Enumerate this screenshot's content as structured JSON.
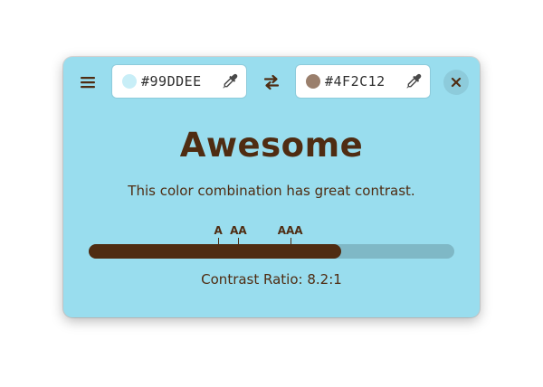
{
  "colors": {
    "background": "#99DDEE",
    "foreground": "#4F2C12",
    "bar_track": "#7fb8c6"
  },
  "header": {
    "menu_icon": "hamburger-menu-icon",
    "foreground_entry": {
      "value": "#99DDEE",
      "swatch_color": "#C8EEF7",
      "picker_icon": "eyedropper-icon"
    },
    "swap_icon": "swap-arrows-icon",
    "background_entry": {
      "value": "#4F2C12",
      "swatch_color": "#9A7F6C",
      "picker_icon": "eyedropper-icon"
    },
    "close_icon": "close-icon"
  },
  "result": {
    "verdict": "Awesome",
    "description": "This color combination has great contrast."
  },
  "levels": {
    "items": [
      {
        "label": "A",
        "ratio": 4.5
      },
      {
        "label": "AA",
        "ratio": 5.2
      },
      {
        "label": "AAA",
        "ratio": 7.0
      }
    ],
    "scale_max": 12.7
  },
  "contrast": {
    "label": "Contrast Ratio:",
    "value": "8.2:1",
    "fill_fraction": 0.69
  }
}
